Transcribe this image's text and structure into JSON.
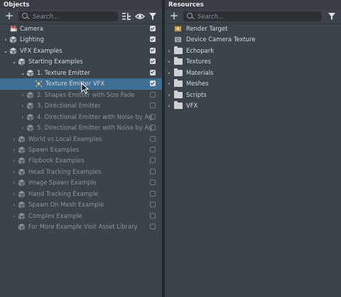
{
  "objects": {
    "title": "Objects",
    "search_placeholder": "Search...",
    "rows": [
      {
        "label": "Camera",
        "arrow": "",
        "indent": 0,
        "icon": "camera-icon",
        "checked": true,
        "dim": false,
        "selected": false
      },
      {
        "label": "Lighting",
        "arrow": "›",
        "indent": 0,
        "icon": "cube-icon",
        "checked": true,
        "dim": false,
        "selected": false
      },
      {
        "label": "VFX Examples",
        "arrow": "⌄",
        "indent": 0,
        "icon": "cube-icon",
        "checked": true,
        "dim": false,
        "selected": false
      },
      {
        "label": "Starting Examples",
        "arrow": "⌄",
        "indent": 1,
        "icon": "cube-icon",
        "checked": true,
        "dim": false,
        "selected": false
      },
      {
        "label": "1. Texture Emitter",
        "arrow": "⌄",
        "indent": 2,
        "icon": "cube-icon",
        "checked": true,
        "dim": false,
        "selected": false
      },
      {
        "label": "Texture Emitter VFX",
        "arrow": "",
        "indent": 3,
        "icon": "vfx-icon",
        "checked": true,
        "dim": false,
        "selected": true
      },
      {
        "label": "2. Shapes Emitter with Size Fade",
        "arrow": "›",
        "indent": 2,
        "icon": "cube-icon",
        "checked": false,
        "dim": true,
        "selected": false
      },
      {
        "label": "3. Directional Emitter",
        "arrow": "›",
        "indent": 2,
        "icon": "cube-icon",
        "checked": false,
        "dim": true,
        "selected": false
      },
      {
        "label": "4. Directional Emitter with Noise by Ag",
        "arrow": "›",
        "indent": 2,
        "icon": "cube-icon",
        "checked": false,
        "dim": true,
        "selected": false
      },
      {
        "label": "5. Directional Emitter with Noise by Ag",
        "arrow": "›",
        "indent": 2,
        "icon": "cube-icon",
        "checked": false,
        "dim": true,
        "selected": false
      },
      {
        "label": "World vs Local Examples",
        "arrow": "›",
        "indent": 1,
        "icon": "cube-icon",
        "checked": false,
        "dim": true,
        "selected": false
      },
      {
        "label": "Spawn Examples",
        "arrow": "›",
        "indent": 1,
        "icon": "cube-icon",
        "checked": false,
        "dim": true,
        "selected": false
      },
      {
        "label": "Flipbook Examples",
        "arrow": "›",
        "indent": 1,
        "icon": "cube-icon",
        "checked": false,
        "dim": true,
        "selected": false
      },
      {
        "label": "Head Tracking Examples",
        "arrow": "›",
        "indent": 1,
        "icon": "cube-icon",
        "checked": false,
        "dim": true,
        "selected": false
      },
      {
        "label": "Image Spawn Example",
        "arrow": "›",
        "indent": 1,
        "icon": "cube-icon",
        "checked": false,
        "dim": true,
        "selected": false
      },
      {
        "label": "Hand Tracking Example",
        "arrow": "›",
        "indent": 1,
        "icon": "cube-icon",
        "checked": false,
        "dim": true,
        "selected": false
      },
      {
        "label": "Spawn On Mesh Example",
        "arrow": "›",
        "indent": 1,
        "icon": "cube-icon",
        "checked": false,
        "dim": true,
        "selected": false
      },
      {
        "label": "Complex Example",
        "arrow": "›",
        "indent": 1,
        "icon": "cube-icon",
        "checked": false,
        "dim": true,
        "selected": false
      },
      {
        "label": "For More Example Visit Asset Library",
        "arrow": "",
        "indent": 1,
        "icon": "cube-icon",
        "checked": false,
        "dim": true,
        "selected": false
      }
    ]
  },
  "resources": {
    "title": "Resources",
    "search_placeholder": "Search...",
    "rows": [
      {
        "label": "Render Target",
        "arrow": "",
        "icon": "render-target-icon"
      },
      {
        "label": "Device Camera Texture",
        "arrow": "",
        "icon": "camera-texture-icon"
      },
      {
        "label": "Echopark",
        "arrow": "›",
        "icon": "folder-icon"
      },
      {
        "label": "Textures",
        "arrow": "›",
        "icon": "folder-icon"
      },
      {
        "label": "Materials",
        "arrow": "›",
        "icon": "folder-icon"
      },
      {
        "label": "Meshes",
        "arrow": "›",
        "icon": "folder-icon"
      },
      {
        "label": "Scripts",
        "arrow": "›",
        "icon": "folder-icon"
      },
      {
        "label": "VFX",
        "arrow": "›",
        "icon": "folder-icon"
      }
    ]
  },
  "colors": {
    "panel_bg": "#3d434a",
    "selection": "#3f6f94",
    "text": "#d6d8db",
    "text_dim": "#8d939a"
  }
}
